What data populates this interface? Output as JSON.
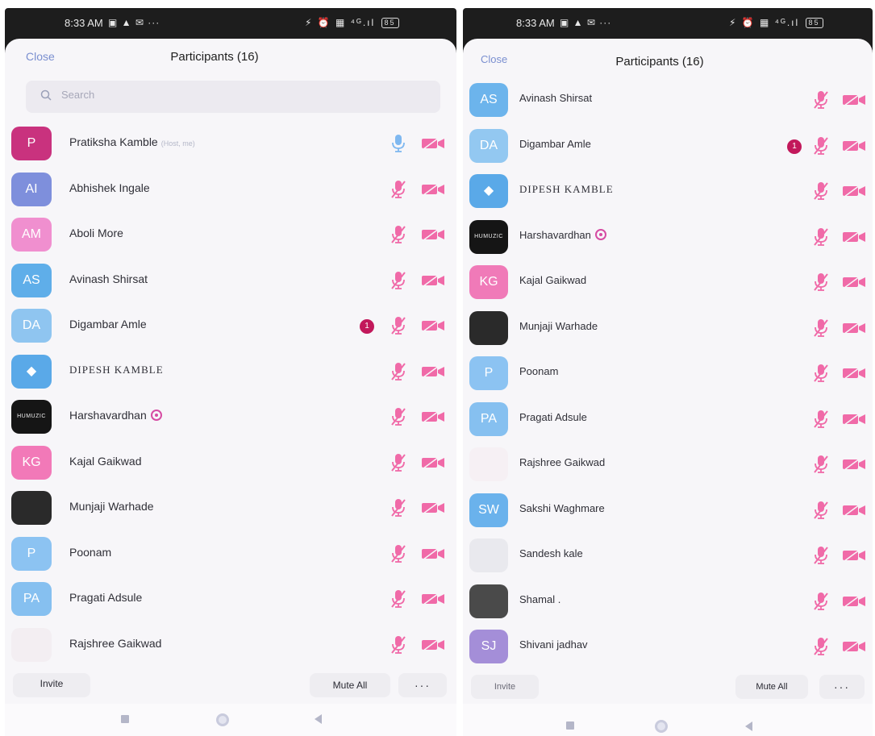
{
  "top_caption": "",
  "colors": {
    "accent_link": "#7a8fd0",
    "muted_pink": "#f06aa8",
    "live_mic_blue": "#7fb8f0",
    "hand_badge": "#c2185b"
  },
  "left": {
    "status": {
      "time": "8:33 AM",
      "left_icons": "▣ ▲ ✉ ···",
      "right_icons": "⚡ ⏰ ▦ ⁴ᴳ.ıl",
      "battery": "85"
    },
    "header": {
      "close_label": "Close",
      "title": "Participants (16)"
    },
    "search": {
      "placeholder": "Search"
    },
    "participants": [
      {
        "initials": "P",
        "avatar_color": "#c9327e",
        "name": "Pratiksha Kamble",
        "tag": "(Host, me)",
        "mic": "on",
        "cam": "off",
        "hand": ""
      },
      {
        "initials": "AI",
        "avatar_color": "#7e8fdc",
        "name": "Abhishek Ingale",
        "tag": "",
        "mic": "off",
        "cam": "off",
        "hand": ""
      },
      {
        "initials": "AM",
        "avatar_color": "#f08fcf",
        "name": "Aboli More",
        "tag": "",
        "mic": "off",
        "cam": "off",
        "hand": ""
      },
      {
        "initials": "AS",
        "avatar_color": "#5faee9",
        "name": "Avinash Shirsat",
        "tag": "",
        "mic": "off",
        "cam": "off",
        "hand": ""
      },
      {
        "initials": "DA",
        "avatar_color": "#8fc5f0",
        "name": "Digambar Amle",
        "tag": "",
        "mic": "off",
        "cam": "off",
        "hand": "1"
      },
      {
        "initials": "◆",
        "avatar_color": "#5aa9e8",
        "name": "DIPESH KAMBLE",
        "tag": "",
        "mic": "off",
        "cam": "off",
        "hand": ""
      },
      {
        "initials": "HUMUZIC",
        "avatar_color": "#151515",
        "name": "Harshavardhan",
        "tag": "",
        "mic": "off",
        "cam": "off",
        "hand": ""
      },
      {
        "initials": "KG",
        "avatar_color": "#f279b8",
        "name": "Kajal Gaikwad",
        "tag": "",
        "mic": "off",
        "cam": "off",
        "hand": ""
      },
      {
        "initials": "",
        "avatar_color": "#2a2a2a",
        "name": "Munjaji Warhade",
        "tag": "",
        "mic": "off",
        "cam": "off",
        "hand": ""
      },
      {
        "initials": "P",
        "avatar_color": "#8cc3f2",
        "name": "Poonam",
        "tag": "",
        "mic": "off",
        "cam": "off",
        "hand": ""
      },
      {
        "initials": "PA",
        "avatar_color": "#86c0f0",
        "name": "Pragati Adsule",
        "tag": "",
        "mic": "off",
        "cam": "off",
        "hand": ""
      },
      {
        "initials": "",
        "avatar_color": "#f3eef2",
        "name": "Rajshree Gaikwad",
        "tag": "",
        "mic": "off",
        "cam": "off",
        "hand": ""
      }
    ],
    "footer": {
      "invite": "Invite",
      "mute_all": "Mute All",
      "more": "···"
    }
  },
  "right": {
    "status": {
      "time": "8:33 AM",
      "left_icons": "▣ ▲ ✉ ···",
      "right_icons": "⚡ ⏰ ▦ ⁴ᴳ.ıl",
      "battery": "85"
    },
    "header": {
      "close_label": "Close",
      "title": "Participants (16)"
    },
    "participants": [
      {
        "initials": "AS",
        "avatar_color": "#6cb4ec",
        "name": "Avinash Shirsat",
        "mic": "off",
        "cam": "off",
        "hand": ""
      },
      {
        "initials": "DA",
        "avatar_color": "#93c8f1",
        "name": "Digambar Amle",
        "mic": "off",
        "cam": "off",
        "hand": "1"
      },
      {
        "initials": "◆",
        "avatar_color": "#5aa9e8",
        "name": "DIPESH KAMBLE",
        "mic": "off",
        "cam": "off",
        "hand": ""
      },
      {
        "initials": "HUMUZIC",
        "avatar_color": "#151515",
        "name": "Harshavardhan",
        "mic": "off",
        "cam": "off",
        "hand": ""
      },
      {
        "initials": "KG",
        "avatar_color": "#f07ab8",
        "name": "Kajal Gaikwad",
        "mic": "off",
        "cam": "off",
        "hand": ""
      },
      {
        "initials": "",
        "avatar_color": "#2a2a2a",
        "name": "Munjaji Warhade",
        "mic": "off",
        "cam": "off",
        "hand": ""
      },
      {
        "initials": "P",
        "avatar_color": "#8cc3f2",
        "name": "Poonam",
        "mic": "off",
        "cam": "off",
        "hand": ""
      },
      {
        "initials": "PA",
        "avatar_color": "#86c0f0",
        "name": "Pragati Adsule",
        "mic": "off",
        "cam": "off",
        "hand": ""
      },
      {
        "initials": "",
        "avatar_color": "#f6f0f4",
        "name": "Rajshree Gaikwad",
        "mic": "off",
        "cam": "off",
        "hand": ""
      },
      {
        "initials": "SW",
        "avatar_color": "#6ab2ec",
        "name": "Sakshi Waghmare",
        "mic": "off",
        "cam": "off",
        "hand": ""
      },
      {
        "initials": "",
        "avatar_color": "#e9e9ee",
        "name": "Sandesh kale",
        "mic": "off",
        "cam": "off",
        "hand": ""
      },
      {
        "initials": "",
        "avatar_color": "#4a4a4a",
        "name": "Shamal .",
        "mic": "off",
        "cam": "off",
        "hand": ""
      },
      {
        "initials": "SJ",
        "avatar_color": "#a48ed8",
        "name": "Shivani jadhav",
        "mic": "off",
        "cam": "off",
        "hand": ""
      }
    ],
    "footer": {
      "invite": "Invite",
      "mute_all": "Mute All",
      "more": "···"
    }
  }
}
